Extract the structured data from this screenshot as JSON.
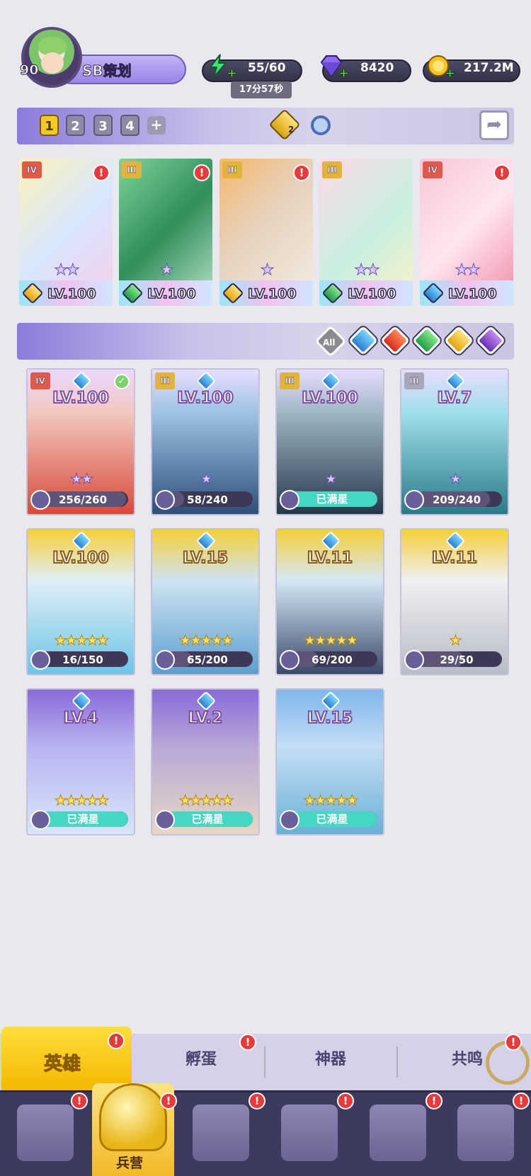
{
  "player": {
    "level": "90",
    "name": "SB策划"
  },
  "resources": {
    "energy": "55/60",
    "energy_timer": "17分57秒",
    "gems": "8420",
    "gold": "217.2M"
  },
  "team": {
    "slots": [
      "1",
      "2",
      "3",
      "4"
    ],
    "add_label": "+",
    "gem_count": "2"
  },
  "team_cards": [
    {
      "rank": "IV",
      "level": "LV.100",
      "element": "gold"
    },
    {
      "rank": "III",
      "level": "LV.100",
      "element": "green"
    },
    {
      "rank": "III",
      "level": "LV.100",
      "element": "gold"
    },
    {
      "rank": "III",
      "level": "LV.100",
      "element": "green"
    },
    {
      "rank": "IV",
      "level": "LV.100",
      "element": "blue"
    }
  ],
  "filters": {
    "all_label": "All",
    "elements": [
      "water",
      "fire",
      "nature",
      "light",
      "dark"
    ]
  },
  "heroes": [
    {
      "rank": "IV",
      "level": "LV.100",
      "progress": "256/260",
      "ratio": 0.98
    },
    {
      "rank": "III",
      "level": "LV.100",
      "progress": "58/240",
      "ratio": 0.24
    },
    {
      "rank": "III",
      "level": "LV.100",
      "progress": "已满星",
      "ratio": 1
    },
    {
      "rank": "III",
      "level": "LV.7",
      "progress": "209/240",
      "ratio": 0.87
    },
    {
      "level": "LV.100",
      "progress": "16/150",
      "ratio": 0.11
    },
    {
      "level": "LV.15",
      "progress": "65/200",
      "ratio": 0.33
    },
    {
      "level": "LV.11",
      "progress": "69/200",
      "ratio": 0.35
    },
    {
      "level": "LV.11",
      "progress": "29/50",
      "ratio": 0.58
    },
    {
      "level": "LV.4",
      "progress": "已满星",
      "ratio": 1
    },
    {
      "level": "LV.2",
      "progress": "已满星",
      "ratio": 1
    },
    {
      "level": "LV.15",
      "progress": "已满星",
      "ratio": 1
    }
  ],
  "subtabs": {
    "hero": "英雄",
    "hatch": "孵蛋",
    "artifact": "神器",
    "resonance": "共鸣"
  },
  "nav": {
    "barracks": "兵营"
  },
  "alerts": {
    "mark": "!",
    "check": "✓"
  },
  "colors": {
    "accent_purple": "#8c7bda",
    "tab_yellow": "#f3b700",
    "alert_red": "#e83a3a"
  }
}
